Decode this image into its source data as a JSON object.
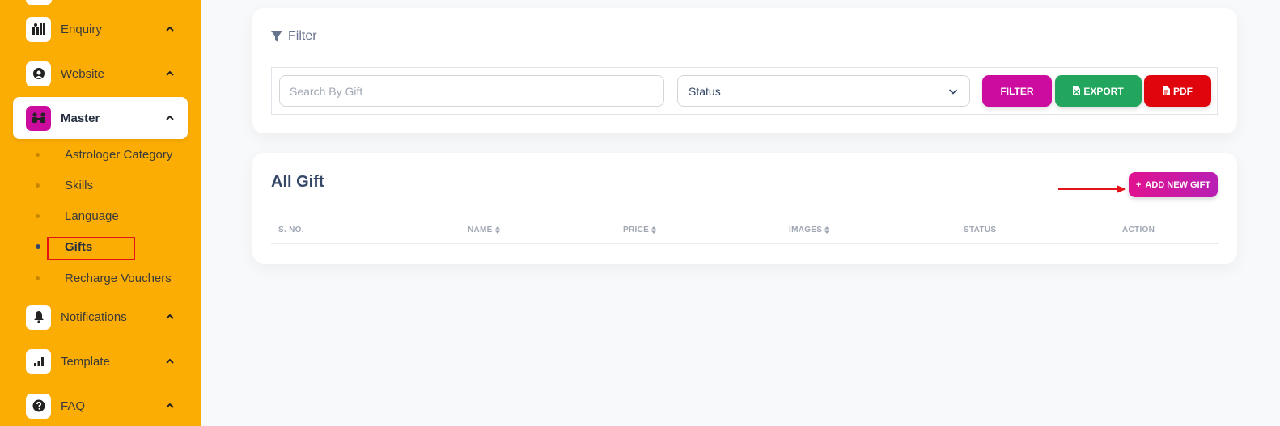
{
  "sidebar": {
    "items": [
      {
        "label": "Enquiry",
        "icon": "enquiry-icon"
      },
      {
        "label": "Website",
        "icon": "website-icon"
      },
      {
        "label": "Master",
        "icon": "master-icon",
        "active": true
      },
      {
        "label": "Notifications",
        "icon": "bell-icon"
      },
      {
        "label": "Template",
        "icon": "chart-bars-icon"
      },
      {
        "label": "FAQ",
        "icon": "question-icon"
      }
    ],
    "master_subitems": [
      {
        "label": "Astrologer Category"
      },
      {
        "label": "Skills"
      },
      {
        "label": "Language"
      },
      {
        "label": "Gifts",
        "active": true
      },
      {
        "label": "Recharge Vouchers"
      }
    ]
  },
  "filter": {
    "title": "Filter",
    "search_placeholder": "Search By Gift",
    "status_label": "Status",
    "filter_button": "FILTER",
    "export_button": "EXPORT",
    "pdf_button": "PDF"
  },
  "list": {
    "title": "All Gift",
    "add_button": "ADD NEW GIFT",
    "columns": [
      "S. NO.",
      "NAME",
      "PRICE",
      "IMAGES",
      "STATUS",
      "ACTION"
    ]
  },
  "colors": {
    "sidebar_bg": "#fcad03",
    "primary": "#cb0c9f",
    "export": "#22a55d",
    "pdf": "#e0050d",
    "highlight": "#e3121b"
  }
}
